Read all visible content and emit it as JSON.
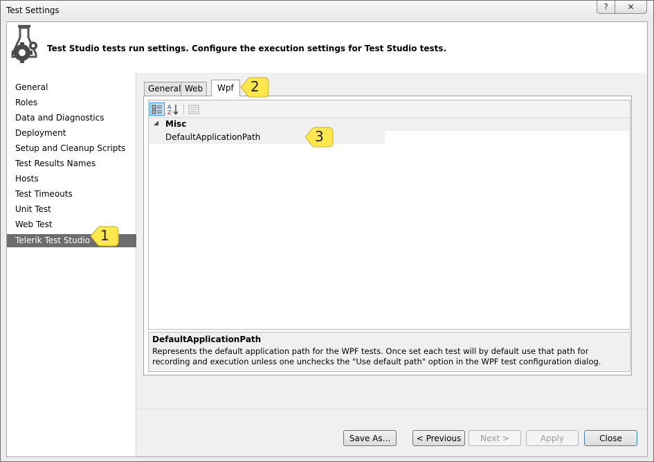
{
  "window": {
    "title": "Test Settings",
    "help_glyph": "?",
    "close_glyph": "✕"
  },
  "header": {
    "icon": "flask-gear-icon",
    "text": "Test Studio tests run settings. Configure the execution settings for Test Studio tests."
  },
  "nav": {
    "items": [
      {
        "label": "General"
      },
      {
        "label": "Roles"
      },
      {
        "label": "Data and Diagnostics"
      },
      {
        "label": "Deployment"
      },
      {
        "label": "Setup and Cleanup Scripts"
      },
      {
        "label": "Test Results Names"
      },
      {
        "label": "Hosts"
      },
      {
        "label": "Test Timeouts"
      },
      {
        "label": "Unit Test"
      },
      {
        "label": "Web Test"
      },
      {
        "label": "Telerik Test Studio"
      }
    ],
    "selected": "Telerik Test Studio"
  },
  "tabs": [
    {
      "label": "General"
    },
    {
      "label": "Web"
    },
    {
      "label": "Wpf"
    }
  ],
  "active_tab": "Wpf",
  "toolbar": {
    "categorized_icon": "categorized-icon",
    "alphabetical_icon": "sort-az-icon",
    "property_pages_icon": "property-pages-icon",
    "alpha_a": "A",
    "alpha_z": "Z"
  },
  "property_grid": {
    "category": "Misc",
    "expand_glyph": "◢",
    "property_name": "DefaultApplicationPath",
    "property_value": ""
  },
  "description": {
    "title": "DefaultApplicationPath",
    "text": "Represents the default application path for the WPF tests. Once set each test will by default use that path for recording and execution unless one unchecks the \"Use default path\" option in the WPF test configuration dialog."
  },
  "callouts": [
    {
      "label": "1"
    },
    {
      "label": "2"
    },
    {
      "label": "3"
    }
  ],
  "buttons": {
    "save_as": "Save As...",
    "previous": "< Previous",
    "next": "Next >",
    "apply": "Apply",
    "close": "Close"
  },
  "colors": {
    "callout_fill": "#fde74c",
    "selected_nav": "#6d6d6d"
  }
}
